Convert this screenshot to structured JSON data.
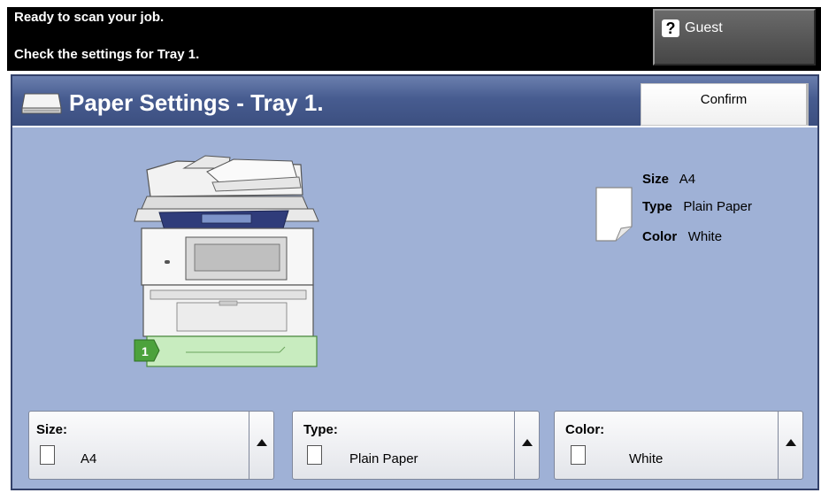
{
  "status": {
    "line1": "Ready to scan your job.",
    "line2": "Check the settings for Tray 1."
  },
  "user": {
    "icon": "question-icon",
    "icon_glyph": "?",
    "label": "Guest"
  },
  "header": {
    "title": "Paper Settings - Tray 1.",
    "confirm_label": "Confirm"
  },
  "tray": {
    "number": "1"
  },
  "paper_info": {
    "size_key": "Size",
    "size_value": "A4",
    "type_key": "Type",
    "type_value": "Plain Paper",
    "color_key": "Color",
    "color_value": "White"
  },
  "selectors": {
    "size": {
      "label": "Size:",
      "value": "A4"
    },
    "type": {
      "label": "Type:",
      "value": "Plain Paper"
    },
    "color": {
      "label": "Color:",
      "value": "White"
    }
  },
  "colors": {
    "panel_bg": "#9fb1d6",
    "title_bg": "#475c90",
    "tray_green": "#c8ecbf",
    "tray_badge": "#4ca23c"
  }
}
